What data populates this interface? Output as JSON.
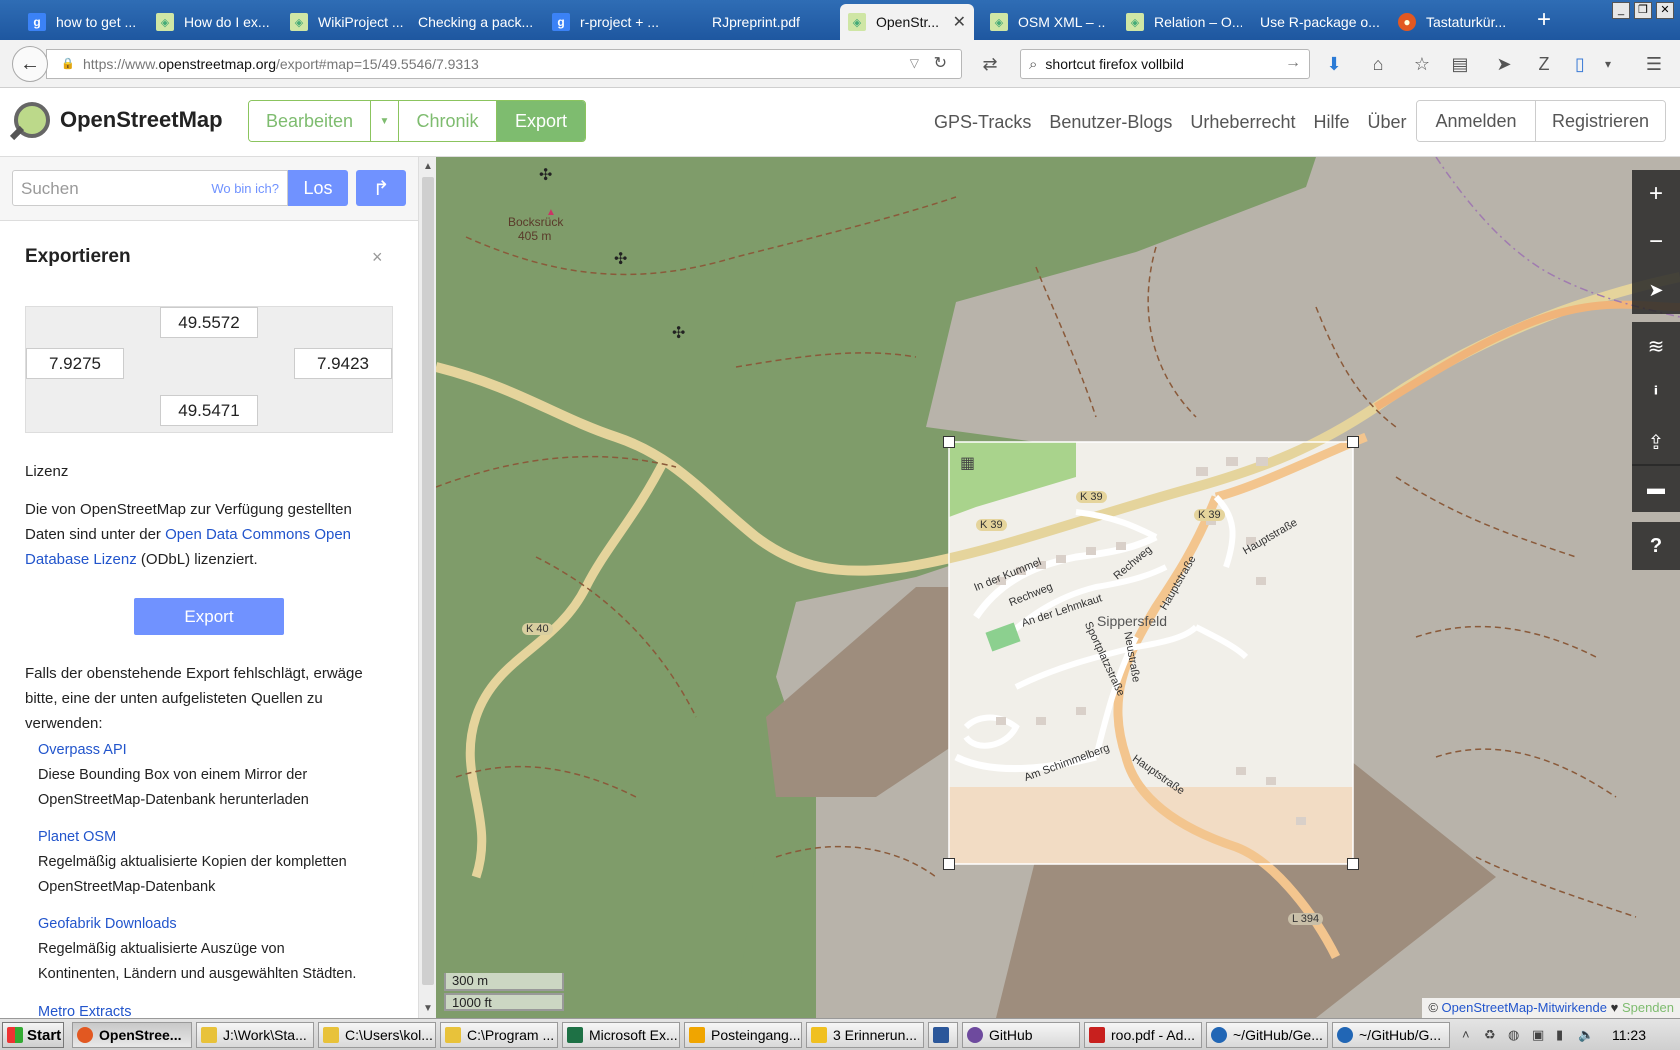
{
  "browser": {
    "tabs": [
      {
        "label": "how to get ...",
        "icon": "google-icon"
      },
      {
        "label": "How do I ex...",
        "icon": "osm-icon"
      },
      {
        "label": "WikiProject ...",
        "icon": "osm-icon"
      },
      {
        "label": "Checking a pack...",
        "icon": "none"
      },
      {
        "label": "r-project + ...",
        "icon": "google-icon"
      },
      {
        "label": "RJpreprint.pdf",
        "icon": "none"
      },
      {
        "label": "OpenStr...",
        "icon": "osm-icon",
        "active": true
      },
      {
        "label": "OSM XML – ...",
        "icon": "osm-icon"
      },
      {
        "label": "Relation – O...",
        "icon": "osm-icon"
      },
      {
        "label": "Use R-package o...",
        "icon": "none"
      },
      {
        "label": "Tastaturkür...",
        "icon": "firefox-icon"
      }
    ],
    "url_prefix": "https://www.",
    "url_domain": "openstreetmap.org",
    "url_rest": "/export#map=15/49.5546/7.9313",
    "search_value": "shortcut firefox vollbild"
  },
  "osm": {
    "brand": "OpenStreetMap",
    "edit_label": "Bearbeiten",
    "history_label": "Chronik",
    "export_label": "Export",
    "links": [
      "GPS-Tracks",
      "Benutzer-Blogs",
      "Urheberrecht",
      "Hilfe",
      "Über"
    ],
    "login_label": "Anmelden",
    "register_label": "Registrieren",
    "accent": "#7ebc6f",
    "button_blue": "#7092ff"
  },
  "sidebar": {
    "search_placeholder": "Suchen",
    "where_am_i": "Wo bin ich?",
    "go_label": "Los",
    "panel_title": "Exportieren",
    "close": "×",
    "bbox": {
      "north": "49.5572",
      "west": "7.9275",
      "east": "7.9423",
      "south": "49.5471"
    },
    "license_heading": "Lizenz",
    "license_text_1": "Die von OpenStreetMap zur Verfügung gestellten Daten sind unter der ",
    "license_link": "Open Data Commons Open Database Lizenz",
    "license_text_2": " (ODbL) lizenziert.",
    "export_button": "Export",
    "fallback_text": "Falls der obenstehende Export fehlschlägt, erwäge bitte, eine der unten aufgelisteten Quellen zu verwenden:",
    "sources": [
      {
        "title": "Overpass API",
        "desc": "Diese Bounding Box von einem Mirror der OpenStreetMap-Datenbank herunterladen"
      },
      {
        "title": "Planet OSM",
        "desc": "Regelmäßig aktualisierte Kopien der kompletten OpenStreetMap-Datenbank"
      },
      {
        "title": "Geofabrik Downloads",
        "desc": "Regelmäßig aktualisierte Auszüge von Kontinenten, Ländern und ausgewählten Städten."
      },
      {
        "title": "Metro Extracts",
        "desc": ""
      }
    ]
  },
  "map": {
    "labels": {
      "peak": "Bocksrück",
      "peak_elev": "405 m",
      "town": "Sippersfeld",
      "k39": "K 39",
      "k40": "K 40",
      "l394": "L 394",
      "hauptstrasse": "Hauptstraße",
      "in_der_kummel": "In der Kummel",
      "rechweg": "Rechweg",
      "an_der_lehmkaut": "An der Lehmkaut",
      "sportplatzstrasse": "Sportplatzstraße",
      "neustrasse": "Neustraße",
      "am_schimmelberg": "Am Schimmelberg"
    },
    "scale_m": "300 m",
    "scale_ft": "1000 ft",
    "attribution_prefix": "© ",
    "attribution_link": "OpenStreetMap-Mitwirkende",
    "attribution_heart": " ♥ ",
    "donate": "Spenden",
    "controls": [
      "zoom-in-icon",
      "zoom-out-icon",
      "locate-icon",
      "layers-icon",
      "info-icon",
      "share-icon",
      "note-icon",
      "query-icon"
    ]
  },
  "taskbar": {
    "start": "Start",
    "items": [
      {
        "label": "OpenStree...",
        "active": true,
        "color": "#e25821"
      },
      {
        "label": "J:\\Work\\Sta...",
        "color": "#e8c23a"
      },
      {
        "label": "C:\\Users\\kol...",
        "color": "#e8c23a"
      },
      {
        "label": "C:\\Program ...",
        "color": "#e8c23a"
      },
      {
        "label": "Microsoft Ex...",
        "color": "#1e7145"
      },
      {
        "label": "Posteingang...",
        "color": "#f0a500"
      },
      {
        "label": "3 Erinnerun...",
        "color": "#f0c020"
      },
      {
        "label": "",
        "color": "#2b579a"
      },
      {
        "label": "GitHub",
        "color": "#6e4a9e"
      },
      {
        "label": "roo.pdf - Ad...",
        "color": "#c8201e"
      },
      {
        "label": "~/GitHub/Ge...",
        "color": "#2166b5"
      },
      {
        "label": "~/GitHub/G...",
        "color": "#2166b5"
      }
    ],
    "clock": "11:23"
  }
}
